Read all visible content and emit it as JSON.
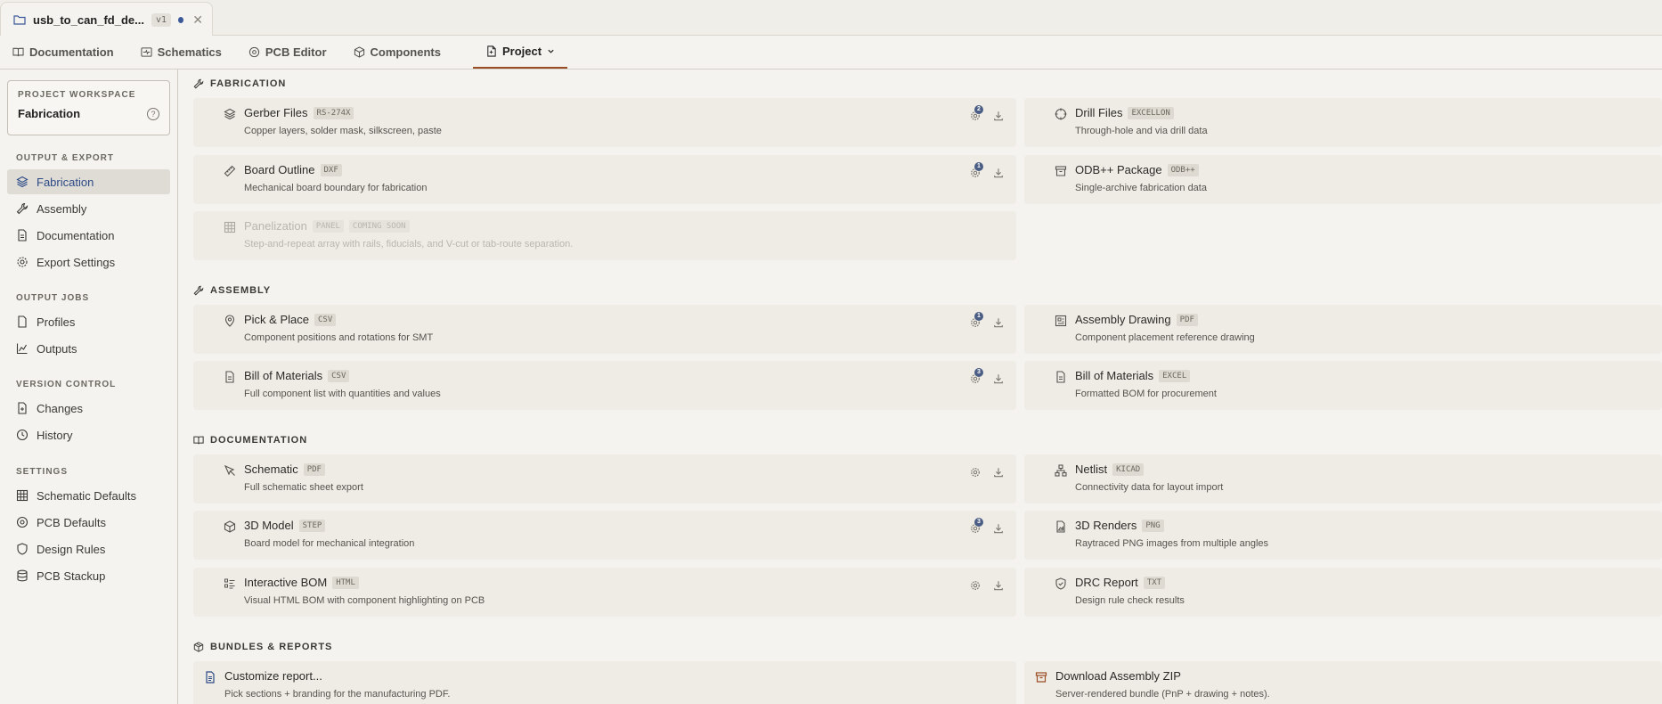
{
  "file_tab": {
    "name": "usb_to_can_fd_de...",
    "version": "v1",
    "close": "✕"
  },
  "nav": [
    {
      "label": "Documentation",
      "icon": "book-icon"
    },
    {
      "label": "Schematics",
      "icon": "schematic-icon"
    },
    {
      "label": "PCB Editor",
      "icon": "chip-icon"
    },
    {
      "label": "Components",
      "icon": "cube-icon"
    },
    {
      "label": "Project",
      "icon": "project-icon",
      "active": true
    }
  ],
  "sidebar": {
    "workspace_label": "PROJECT WORKSPACE",
    "workspace_value": "Fabrication",
    "workspace_help": "?",
    "sections": [
      {
        "title": "OUTPUT & EXPORT",
        "items": [
          "Fabrication",
          "Assembly",
          "Documentation",
          "Export Settings"
        ]
      },
      {
        "title": "OUTPUT JOBS",
        "items": [
          "Profiles",
          "Outputs"
        ]
      },
      {
        "title": "VERSION CONTROL",
        "items": [
          "Changes",
          "History"
        ]
      },
      {
        "title": "SETTINGS",
        "items": [
          "Schematic Defaults",
          "PCB Defaults",
          "Design Rules",
          "PCB Stackup"
        ]
      }
    ],
    "active_item": "Fabrication"
  },
  "groups": {
    "fabrication": "FABRICATION",
    "assembly": "ASSEMBLY",
    "documentation": "DOCUMENTATION",
    "bundles": "BUNDLES & REPORTS"
  },
  "cards": {
    "gerber": {
      "title": "Gerber Files",
      "tag": "RS-274X",
      "sub": "Copper layers, solder mask, silkscreen, paste",
      "badge": "2"
    },
    "drill": {
      "title": "Drill Files",
      "tag": "EXCELLON",
      "sub": "Through-hole and via drill data"
    },
    "outline": {
      "title": "Board Outline",
      "tag": "DXF",
      "sub": "Mechanical board boundary for fabrication",
      "badge": "1"
    },
    "odb": {
      "title": "ODB++ Package",
      "tag": "ODB++",
      "sub": "Single-archive fabrication data"
    },
    "panel": {
      "title": "Panelization",
      "tag": "PANEL",
      "tag2": "COMING SOON",
      "sub": "Step-and-repeat array with rails, fiducials, and V-cut or tab-route separation."
    },
    "pnp": {
      "title": "Pick & Place",
      "tag": "CSV",
      "sub": "Component positions and rotations for SMT",
      "badge": "1"
    },
    "asm_drawing": {
      "title": "Assembly Drawing",
      "tag": "PDF",
      "sub": "Component placement reference drawing"
    },
    "bom_csv": {
      "title": "Bill of Materials",
      "tag": "CSV",
      "sub": "Full component list with quantities and values",
      "badge": "3"
    },
    "bom_excel": {
      "title": "Bill of Materials",
      "tag": "EXCEL",
      "sub": "Formatted BOM for procurement"
    },
    "schematic": {
      "title": "Schematic",
      "tag": "PDF",
      "sub": "Full schematic sheet export"
    },
    "netlist": {
      "title": "Netlist",
      "tag": "KICAD",
      "sub": "Connectivity data for layout import"
    },
    "model3d": {
      "title": "3D Model",
      "tag": "STEP",
      "sub": "Board model for mechanical integration",
      "badge": "3"
    },
    "renders": {
      "title": "3D Renders",
      "tag": "PNG",
      "sub": "Raytraced PNG images from multiple angles"
    },
    "ibom": {
      "title": "Interactive BOM",
      "tag": "HTML",
      "sub": "Visual HTML BOM with component highlighting on PCB"
    },
    "drc": {
      "title": "DRC Report",
      "tag": "TXT",
      "sub": "Design rule check results"
    },
    "report": {
      "title": "Customize report...",
      "sub": "Pick sections + branding for the manufacturing PDF."
    },
    "zip": {
      "title": "Download Assembly ZIP",
      "sub": "Server-rendered bundle (PnP + drawing + notes)."
    }
  },
  "colors": {
    "accent": "#9a4d24",
    "active_text": "#2c4a86",
    "badge": "#4a5d84"
  }
}
